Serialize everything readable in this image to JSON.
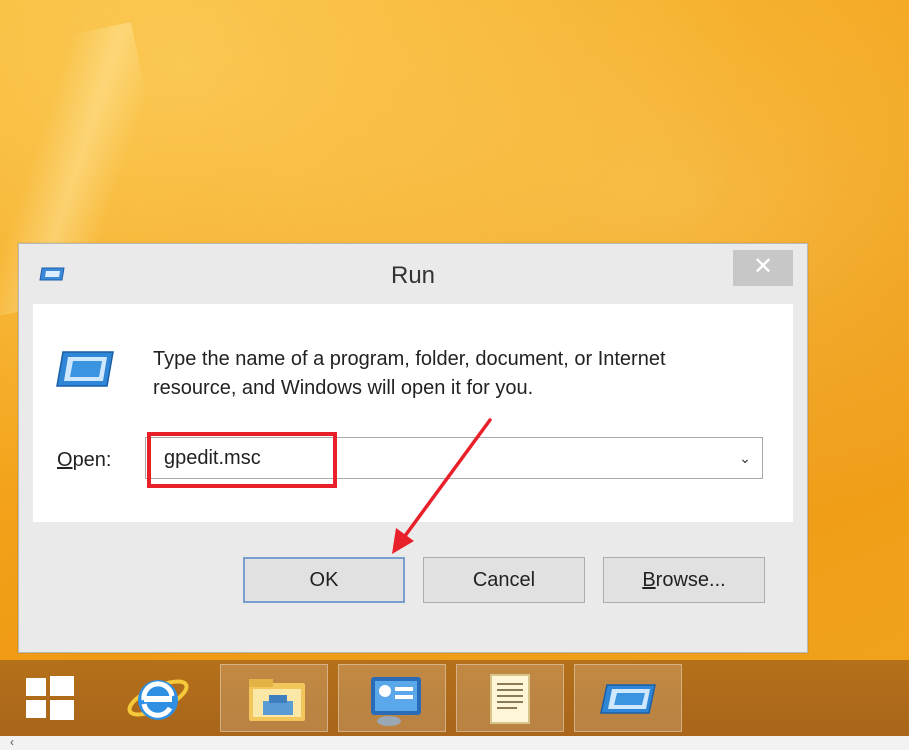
{
  "window": {
    "title": "Run",
    "close_label": "✕"
  },
  "prompt": {
    "line1": "Type the name of a program, folder, document, or Internet",
    "line2": "resource, and Windows will open it for you."
  },
  "open_field": {
    "label_underlined": "O",
    "label_rest": "pen:",
    "value": "gpedit.msc",
    "dropdown_glyph": "⌄"
  },
  "buttons": {
    "ok": "OK",
    "cancel": "Cancel",
    "browse_underlined": "B",
    "browse_rest": "rowse..."
  },
  "taskbar": {
    "items": [
      {
        "icon": "windows-start-icon"
      },
      {
        "icon": "internet-explorer-icon"
      },
      {
        "icon": "file-explorer-icon"
      },
      {
        "icon": "control-panel-icon"
      },
      {
        "icon": "notepad-scroll-icon"
      },
      {
        "icon": "run-dialog-icon"
      }
    ]
  },
  "colors": {
    "desktop": "#f4a51c",
    "taskbar": "#b06c1a",
    "highlight": "#e8202a",
    "ok_border": "#7a9ed0"
  }
}
